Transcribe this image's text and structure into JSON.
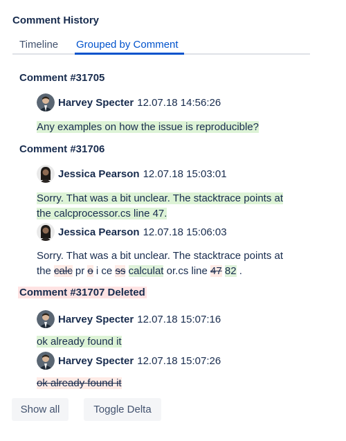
{
  "panel": {
    "title": "Comment History"
  },
  "tabs": [
    {
      "label": "Timeline",
      "active": false
    },
    {
      "label": "Grouped by Comment",
      "active": true
    }
  ],
  "groups": [
    {
      "heading": "Comment #31705",
      "entries": [
        {
          "user": "Harvey Specter",
          "time": "12.07.18 14:56:26",
          "avatar": "harvey-avatar",
          "text": "Any examples on how the issue is reproducible?"
        }
      ]
    },
    {
      "heading": "Comment #31706",
      "entries": [
        {
          "user": "Jessica Pearson",
          "time": "12.07.18 15:03:01",
          "avatar": "jessica-avatar",
          "text_line1": "Sorry. That was a bit unclear. The stacktrace points at",
          "text_line2": "the calcprocessor.cs line 47."
        },
        {
          "user": "Jessica Pearson",
          "time": "12.07.18 15:06:03",
          "avatar": "jessica-avatar",
          "text_line1": "Sorry. That was a bit unclear. The stacktrace points at",
          "delta": {
            "p0": "the ",
            "r1": "calc",
            "p1": " pr ",
            "r2": "o",
            "p2": " i ce ",
            "r3": "ss",
            "p3": " ",
            "a1": "calculat",
            "p4": " or.cs line ",
            "r4": "47",
            "p5": " ",
            "a2": "82",
            "p6": " ."
          }
        }
      ]
    },
    {
      "heading": "Comment #31707 Deleted",
      "deleted": true,
      "entries": [
        {
          "user": "Harvey Specter",
          "time": "12.07.18 15:07:16",
          "avatar": "harvey-avatar",
          "text": "ok already found it"
        },
        {
          "user": "Harvey Specter",
          "time": "12.07.18 15:07:26",
          "avatar": "harvey-avatar",
          "text": "ok already found it",
          "removed": true
        }
      ]
    }
  ],
  "buttons": {
    "show_all": "Show all",
    "toggle_delta": "Toggle Delta"
  },
  "colors": {
    "accent": "#0052cc",
    "added": "#ddf3d6",
    "removed": "#ffebe6",
    "text": "#172b4d"
  }
}
